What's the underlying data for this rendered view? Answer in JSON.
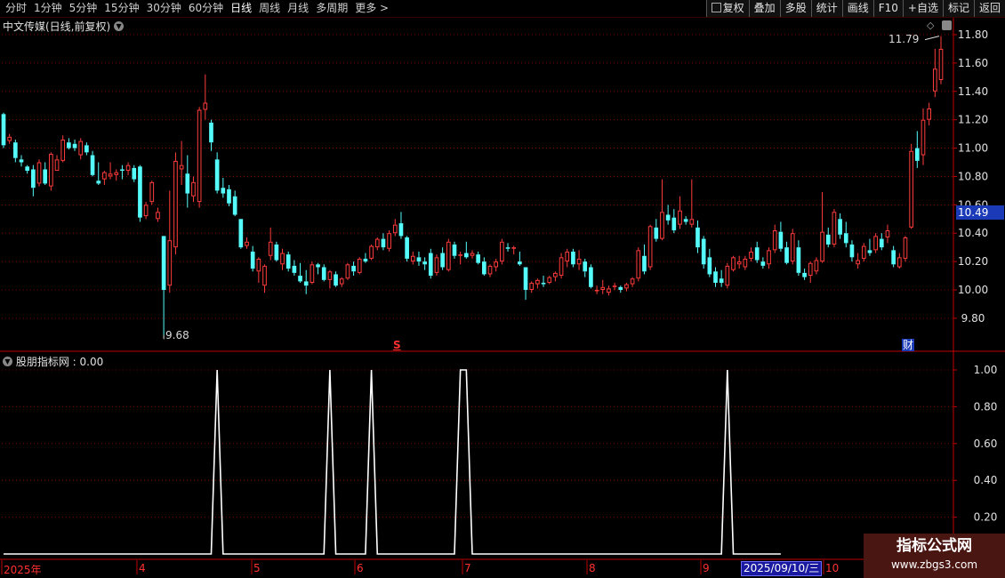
{
  "toolbar": {
    "periods": [
      "分时",
      "1分钟",
      "5分钟",
      "15分钟",
      "30分钟",
      "60分钟",
      "日线",
      "周线",
      "月线",
      "多周期",
      "更多 >"
    ],
    "active_period": "日线",
    "right_buttons": [
      "复权",
      "叠加",
      "多股",
      "统计",
      "画线",
      "F10",
      "+自选",
      "标记",
      "返回"
    ]
  },
  "main_chart": {
    "title": "中文传媒(日线,前复权)",
    "current_price_tag": "10.49",
    "high_marker": "11.79",
    "low_marker": "9.68",
    "s_marker": "S",
    "cai_marker": "财"
  },
  "sub_chart": {
    "title": "股朋指标网 : 0.00"
  },
  "timeline": {
    "labels": [
      "2025年",
      "4",
      "5",
      "6",
      "7",
      "8",
      "9",
      "10"
    ],
    "selected_date": "2025/09/10/三"
  },
  "watermark": {
    "line1": "指标公式网",
    "line2": "www.zbgs3.com"
  },
  "colors": {
    "up": "#ff3c3c",
    "down": "#54fcfc",
    "grid": "#7a0000",
    "axis": "#c00000",
    "indicator": "#ffffff"
  },
  "chart_data": [
    {
      "type": "candlestick",
      "title": "中文传媒(日线,前复权)",
      "ylim": [
        9.6,
        11.9
      ],
      "yticks": [
        9.8,
        10.0,
        10.2,
        10.4,
        10.6,
        10.8,
        11.0,
        11.2,
        11.4,
        11.6,
        11.8
      ],
      "high": 11.79,
      "low": 9.68,
      "last": 10.49,
      "ohlc": [
        [
          11.24,
          11.25,
          11.0,
          11.02
        ],
        [
          11.05,
          11.1,
          11.03,
          11.08
        ],
        [
          11.04,
          11.06,
          10.9,
          10.93
        ],
        [
          10.92,
          10.95,
          10.87,
          10.9
        ],
        [
          10.87,
          10.88,
          10.82,
          10.84
        ],
        [
          10.85,
          10.88,
          10.66,
          10.72
        ],
        [
          10.75,
          10.92,
          10.73,
          10.9
        ],
        [
          10.85,
          10.9,
          10.74,
          10.75
        ],
        [
          10.73,
          10.97,
          10.7,
          10.96
        ],
        [
          10.84,
          10.95,
          10.84,
          10.92
        ],
        [
          10.91,
          11.09,
          10.9,
          11.06
        ],
        [
          11.04,
          11.07,
          10.99,
          11.0
        ],
        [
          11.03,
          11.06,
          10.98,
          11.0
        ],
        [
          10.95,
          11.07,
          10.92,
          11.05
        ],
        [
          11.02,
          11.04,
          10.95,
          10.97
        ],
        [
          10.95,
          10.98,
          10.8,
          10.81
        ],
        [
          10.77,
          10.9,
          10.74,
          10.75
        ],
        [
          10.78,
          10.84,
          10.74,
          10.83
        ],
        [
          10.8,
          10.9,
          10.78,
          10.82
        ],
        [
          10.81,
          10.85,
          10.77,
          10.83
        ],
        [
          10.85,
          10.88,
          10.78,
          10.84
        ],
        [
          10.84,
          10.9,
          10.81,
          10.88
        ],
        [
          10.86,
          10.88,
          10.76,
          10.78
        ],
        [
          10.87,
          10.88,
          10.48,
          10.51
        ],
        [
          10.52,
          10.62,
          10.5,
          10.6
        ],
        [
          10.62,
          10.77,
          10.6,
          10.76
        ],
        [
          10.5,
          10.58,
          10.48,
          10.55
        ],
        [
          10.38,
          10.38,
          9.68,
          10.0
        ],
        [
          10.03,
          10.7,
          9.98,
          10.35
        ],
        [
          10.3,
          10.97,
          10.25,
          10.91
        ],
        [
          10.85,
          11.05,
          10.74,
          10.88
        ],
        [
          10.82,
          10.95,
          10.58,
          10.68
        ],
        [
          10.66,
          10.8,
          10.62,
          10.76
        ],
        [
          10.62,
          11.29,
          10.58,
          11.27
        ],
        [
          11.27,
          11.52,
          11.2,
          11.32
        ],
        [
          11.18,
          11.2,
          10.98,
          11.04
        ],
        [
          10.92,
          10.97,
          10.68,
          10.7
        ],
        [
          10.72,
          10.79,
          10.65,
          10.68
        ],
        [
          10.71,
          10.74,
          10.59,
          10.61
        ],
        [
          10.66,
          10.7,
          10.52,
          10.53
        ],
        [
          10.5,
          10.5,
          10.29,
          10.3
        ],
        [
          10.31,
          10.37,
          10.29,
          10.34
        ],
        [
          10.27,
          10.31,
          10.13,
          10.15
        ],
        [
          10.13,
          10.23,
          10.05,
          10.22
        ],
        [
          10.03,
          10.18,
          9.98,
          10.17
        ],
        [
          10.24,
          10.44,
          10.21,
          10.34
        ],
        [
          10.32,
          10.34,
          10.2,
          10.21
        ],
        [
          10.18,
          10.29,
          10.14,
          10.26
        ],
        [
          10.25,
          10.27,
          10.13,
          10.15
        ],
        [
          10.17,
          10.21,
          10.1,
          10.12
        ],
        [
          10.1,
          10.19,
          10.05,
          10.06
        ],
        [
          10.06,
          10.14,
          9.97,
          10.03
        ],
        [
          10.05,
          10.2,
          10.04,
          10.18
        ],
        [
          10.18,
          10.19,
          10.11,
          10.16
        ],
        [
          10.16,
          10.18,
          10.06,
          10.07
        ],
        [
          10.07,
          10.14,
          10.01,
          10.13
        ],
        [
          10.11,
          10.13,
          10.02,
          10.03
        ],
        [
          10.04,
          10.09,
          10.02,
          10.08
        ],
        [
          10.08,
          10.19,
          10.07,
          10.18
        ],
        [
          10.17,
          10.2,
          10.1,
          10.13
        ],
        [
          10.12,
          10.23,
          10.11,
          10.22
        ],
        [
          10.22,
          10.26,
          10.19,
          10.2
        ],
        [
          10.22,
          10.32,
          10.21,
          10.31
        ],
        [
          10.3,
          10.37,
          10.28,
          10.36
        ],
        [
          10.36,
          10.4,
          10.28,
          10.3
        ],
        [
          10.29,
          10.42,
          10.27,
          10.4
        ],
        [
          10.4,
          10.5,
          10.38,
          10.46
        ],
        [
          10.47,
          10.55,
          10.36,
          10.38
        ],
        [
          10.37,
          10.38,
          10.2,
          10.22
        ],
        [
          10.2,
          10.27,
          10.18,
          10.24
        ],
        [
          10.23,
          10.27,
          10.17,
          10.2
        ],
        [
          10.2,
          10.23,
          10.14,
          10.18
        ],
        [
          10.26,
          10.29,
          10.08,
          10.1
        ],
        [
          10.12,
          10.25,
          10.1,
          10.23
        ],
        [
          10.26,
          10.3,
          10.14,
          10.16
        ],
        [
          10.14,
          10.36,
          10.13,
          10.34
        ],
        [
          10.32,
          10.34,
          10.22,
          10.24
        ],
        [
          10.24,
          10.27,
          10.18,
          10.25
        ],
        [
          10.26,
          10.34,
          10.22,
          10.23
        ],
        [
          10.24,
          10.28,
          10.22,
          10.26
        ],
        [
          10.25,
          10.27,
          10.18,
          10.19
        ],
        [
          10.2,
          10.23,
          10.1,
          10.11
        ],
        [
          10.11,
          10.18,
          10.09,
          10.17
        ],
        [
          10.16,
          10.22,
          10.13,
          10.2
        ],
        [
          10.2,
          10.36,
          10.18,
          10.34
        ],
        [
          10.3,
          10.33,
          10.27,
          10.29
        ],
        [
          10.29,
          10.31,
          10.25,
          10.3
        ],
        [
          10.2,
          10.27,
          10.17,
          10.18
        ],
        [
          10.16,
          10.16,
          9.93,
          10.0
        ],
        [
          10.0,
          10.06,
          9.98,
          10.05
        ],
        [
          10.04,
          10.08,
          10.01,
          10.07
        ],
        [
          10.05,
          10.1,
          10.02,
          10.04
        ],
        [
          10.05,
          10.1,
          10.04,
          10.09
        ],
        [
          10.09,
          10.13,
          10.06,
          10.12
        ],
        [
          10.1,
          10.26,
          10.08,
          10.23
        ],
        [
          10.2,
          10.29,
          10.16,
          10.27
        ],
        [
          10.27,
          10.29,
          10.16,
          10.18
        ],
        [
          10.18,
          10.28,
          10.14,
          10.22
        ],
        [
          10.2,
          10.22,
          10.09,
          10.13
        ],
        [
          10.16,
          10.18,
          10.01,
          10.02
        ],
        [
          10.0,
          10.03,
          9.97,
          10.0
        ],
        [
          10.0,
          10.07,
          9.97,
          10.02
        ],
        [
          9.98,
          10.03,
          9.96,
          10.01
        ],
        [
          10.02,
          10.05,
          10.0,
          10.03
        ],
        [
          10.02,
          10.03,
          9.98,
          10.0
        ],
        [
          10.01,
          10.05,
          9.99,
          10.04
        ],
        [
          10.04,
          10.09,
          10.02,
          10.08
        ],
        [
          10.08,
          10.3,
          10.06,
          10.28
        ],
        [
          10.24,
          10.32,
          10.11,
          10.13
        ],
        [
          10.16,
          10.46,
          10.14,
          10.45
        ],
        [
          10.44,
          10.5,
          10.34,
          10.36
        ],
        [
          10.36,
          10.78,
          10.35,
          10.55
        ],
        [
          10.53,
          10.6,
          10.46,
          10.49
        ],
        [
          10.51,
          10.57,
          10.4,
          10.42
        ],
        [
          10.46,
          10.66,
          10.43,
          10.56
        ],
        [
          10.5,
          10.52,
          10.46,
          10.48
        ],
        [
          10.46,
          10.78,
          10.44,
          10.5
        ],
        [
          10.44,
          10.49,
          10.26,
          10.3
        ],
        [
          10.36,
          10.38,
          10.15,
          10.18
        ],
        [
          10.23,
          10.29,
          10.09,
          10.11
        ],
        [
          10.13,
          10.16,
          10.02,
          10.05
        ],
        [
          10.08,
          10.14,
          10.02,
          10.05
        ],
        [
          10.03,
          10.19,
          10.01,
          10.17
        ],
        [
          10.14,
          10.24,
          10.13,
          10.23
        ],
        [
          10.18,
          10.24,
          10.15,
          10.2
        ],
        [
          10.16,
          10.24,
          10.14,
          10.22
        ],
        [
          10.22,
          10.3,
          10.2,
          10.27
        ],
        [
          10.3,
          10.34,
          10.19,
          10.21
        ],
        [
          10.2,
          10.23,
          10.15,
          10.17
        ],
        [
          10.18,
          10.3,
          10.15,
          10.28
        ],
        [
          10.28,
          10.46,
          10.26,
          10.42
        ],
        [
          10.41,
          10.48,
          10.27,
          10.29
        ],
        [
          10.3,
          10.34,
          10.18,
          10.19
        ],
        [
          10.2,
          10.43,
          10.18,
          10.4
        ],
        [
          10.3,
          10.35,
          10.1,
          10.12
        ],
        [
          10.12,
          10.15,
          10.07,
          10.09
        ],
        [
          10.1,
          10.2,
          10.05,
          10.19
        ],
        [
          10.13,
          10.23,
          10.11,
          10.21
        ],
        [
          10.2,
          10.69,
          10.19,
          10.41
        ],
        [
          10.39,
          10.44,
          10.3,
          10.32
        ],
        [
          10.32,
          10.57,
          10.3,
          10.55
        ],
        [
          10.5,
          10.54,
          10.36,
          10.39
        ],
        [
          10.4,
          10.48,
          10.3,
          10.33
        ],
        [
          10.32,
          10.35,
          10.2,
          10.23
        ],
        [
          10.18,
          10.26,
          10.15,
          10.21
        ],
        [
          10.22,
          10.33,
          10.2,
          10.31
        ],
        [
          10.28,
          10.36,
          10.24,
          10.26
        ],
        [
          10.28,
          10.4,
          10.26,
          10.38
        ],
        [
          10.36,
          10.4,
          10.28,
          10.3
        ],
        [
          10.37,
          10.46,
          10.33,
          10.42
        ],
        [
          10.28,
          10.31,
          10.16,
          10.18
        ],
        [
          10.16,
          10.26,
          10.15,
          10.23
        ],
        [
          10.22,
          10.38,
          10.2,
          10.37
        ],
        [
          10.44,
          11.03,
          10.43,
          10.98
        ],
        [
          11.0,
          11.12,
          10.86,
          10.91
        ],
        [
          10.95,
          11.28,
          10.88,
          11.2
        ],
        [
          11.2,
          11.32,
          11.16,
          11.28
        ],
        [
          11.4,
          11.7,
          11.36,
          11.56
        ],
        [
          11.48,
          11.79,
          11.45,
          11.7
        ]
      ]
    },
    {
      "type": "line",
      "title": "股朋指标网 : 0.00",
      "ylim": [
        0,
        1.05
      ],
      "yticks": [
        0.2,
        0.4,
        0.6,
        0.8,
        1.0
      ],
      "x": [
        0,
        35,
        36,
        37,
        54,
        55,
        56,
        61,
        62,
        63,
        76,
        77,
        78,
        79,
        121,
        122,
        123,
        131
      ],
      "values": [
        0,
        0,
        1,
        0,
        0,
        1,
        0,
        0,
        1,
        0,
        0,
        1,
        1,
        0,
        0,
        1,
        0,
        0
      ]
    }
  ]
}
